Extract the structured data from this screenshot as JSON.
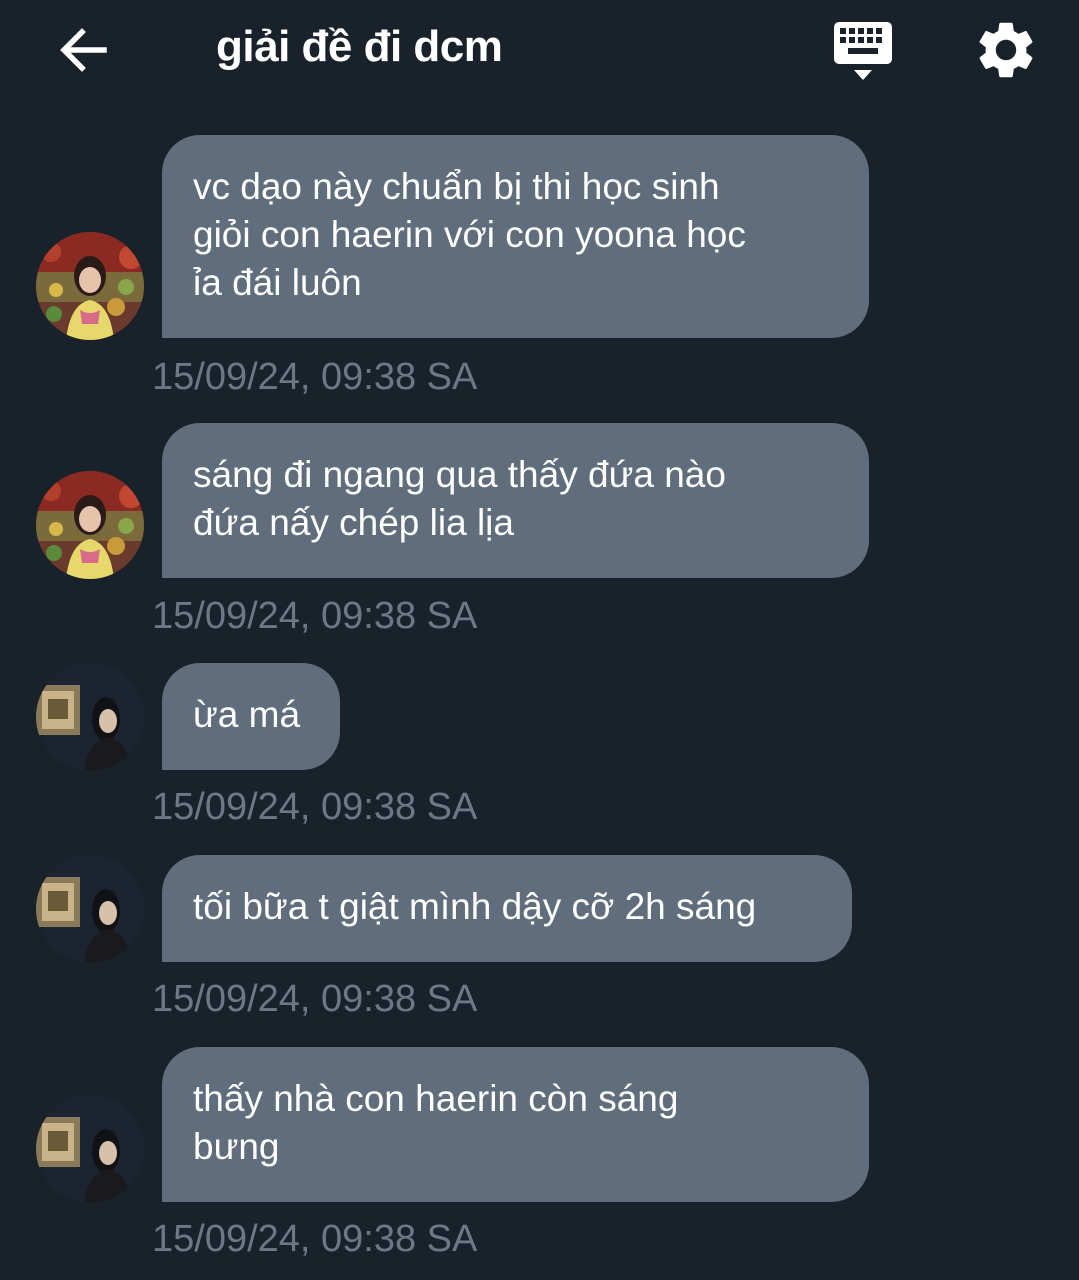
{
  "header": {
    "title": "giải đề đi dcm",
    "back_icon": "arrow-left-icon",
    "keyboard_icon": "keyboard-icon",
    "settings_icon": "gear-icon"
  },
  "colors": {
    "background": "#19212b",
    "bubble": "#5f6d7c",
    "timestamp": "#6d7885",
    "text": "#ffffff"
  },
  "messages": [
    {
      "avatar": "avatar-user-a",
      "text": "vc dạo này chuẩn bị thi học sinh\ngiỏi con haerin với con yoona học\nỉa đái luôn",
      "time": "15/09/24, 09:38 SA"
    },
    {
      "avatar": "avatar-user-a",
      "text": "sáng đi ngang qua thấy đứa nào\nđứa nấy chép lia lịa",
      "time": "15/09/24, 09:38 SA"
    },
    {
      "avatar": "avatar-user-b",
      "text": "ừa má",
      "time": "15/09/24, 09:38 SA"
    },
    {
      "avatar": "avatar-user-b",
      "text": "tối bữa t giật mình dậy cỡ 2h sáng",
      "time": "15/09/24, 09:38 SA"
    },
    {
      "avatar": "avatar-user-b",
      "text": "thấy nhà con haerin còn sáng\nbưng",
      "time": "15/09/24, 09:38 SA"
    }
  ]
}
